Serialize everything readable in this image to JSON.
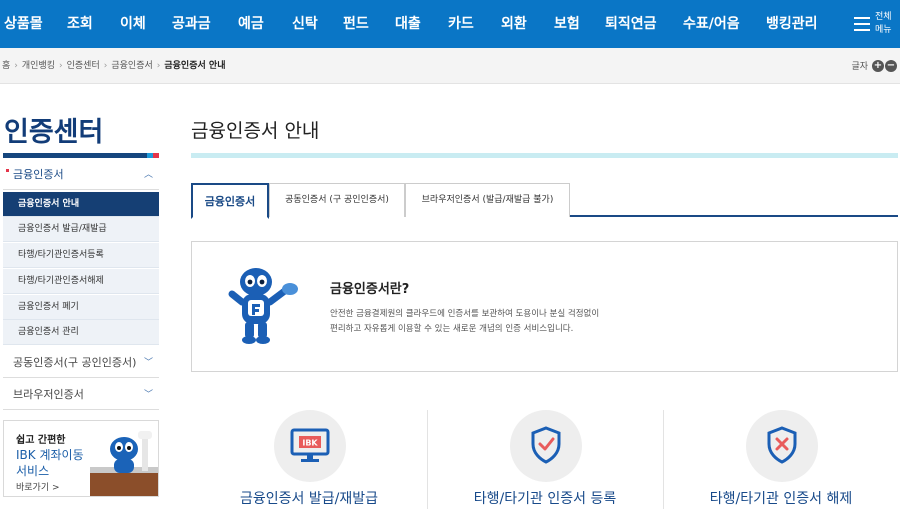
{
  "nav": {
    "items": [
      "상품몰",
      "조회",
      "이체",
      "공과금",
      "예금",
      "신탁",
      "펀드",
      "대출",
      "카드",
      "외환",
      "보험",
      "퇴직연금",
      "수표/어음",
      "뱅킹관리"
    ],
    "all_menu": "전체메뉴"
  },
  "breadcrumb": {
    "items": [
      "홈",
      "개인뱅킹",
      "인증센터",
      "금융인증서"
    ],
    "current": "금융인증서 안내"
  },
  "font_size": {
    "label": "글자",
    "increase": "+",
    "decrease": "−"
  },
  "sidebar": {
    "title": "인증센터",
    "section1": "금융인증서",
    "sub_items": [
      "금융인증서 안내",
      "금융인증서 발급/재발급",
      "타행/타기관인증서등록",
      "타행/타기관인증서해제",
      "금융인증서 폐기",
      "금융인증서 관리"
    ],
    "section2": "공동인증서(구 공인인증서)",
    "section3": "브라우저인증서",
    "banner": {
      "line1": "쉽고 간편한",
      "line2": "IBK 계좌이동",
      "line3": "서비스",
      "link": "바로가기 >"
    }
  },
  "main": {
    "title": "금융인증서 안내",
    "tabs": [
      "금융인증서",
      "공동인증서 (구 공인인증서)",
      "브라우저인증서 (발급/재발급 불가)"
    ],
    "info": {
      "heading": "금융인증서란?",
      "line1": "안전한 금융결제원의 클라우드에 인증서를 보관하여 도용이나 분실 걱정없이",
      "line2": "편리하고 자유롭게 이용할 수 있는 새로운 개념의 인증 서비스입니다."
    },
    "features": [
      "금융인증서 발급/재발급",
      "타행/타기관 인증서 등록",
      "타행/타기관 인증서 해제"
    ],
    "ibk_badge": "IBK"
  },
  "colors": {
    "nav_bg": "#0a76c6",
    "brand_navy": "#153f74",
    "accent_red": "#e4354a",
    "accent_cyan": "#c9ecf2"
  }
}
